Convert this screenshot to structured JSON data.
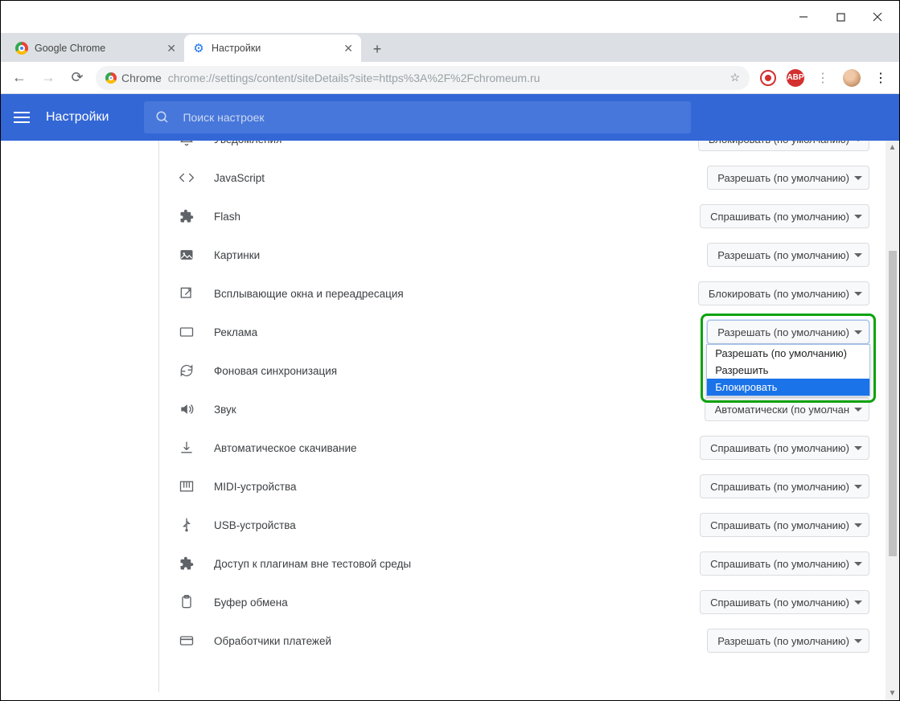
{
  "window": {
    "tabs": [
      {
        "title": "Google Chrome",
        "active": false
      },
      {
        "title": "Настройки",
        "active": true
      }
    ],
    "addressbar": {
      "scheme_label": "Chrome",
      "url": "chrome://settings/content/siteDetails?site=https%3A%2F%2Fchromeum.ru"
    }
  },
  "settings_header": {
    "title": "Настройки",
    "search_placeholder": "Поиск настроек"
  },
  "permissions": [
    {
      "icon": "bell",
      "label": "Уведомления",
      "value": "Блокировать (по умолчанию)"
    },
    {
      "icon": "code",
      "label": "JavaScript",
      "value": "Разрешать (по умолчанию)"
    },
    {
      "icon": "puzzle",
      "label": "Flash",
      "value": "Спрашивать (по умолчанию)"
    },
    {
      "icon": "image",
      "label": "Картинки",
      "value": "Разрешать (по умолчанию)"
    },
    {
      "icon": "popup",
      "label": "Всплывающие окна и переадресация",
      "value": "Блокировать (по умолчанию)"
    },
    {
      "icon": "rect",
      "label": "Реклама",
      "value": "Разрешать (по умолчанию)",
      "open": true
    },
    {
      "icon": "sync",
      "label": "Фоновая синхронизация",
      "value": ""
    },
    {
      "icon": "sound",
      "label": "Звук",
      "value": "Автоматически (по умолчан"
    },
    {
      "icon": "download",
      "label": "Автоматическое скачивание",
      "value": "Спрашивать (по умолчанию)"
    },
    {
      "icon": "midi",
      "label": "MIDI-устройства",
      "value": "Спрашивать (по умолчанию)"
    },
    {
      "icon": "usb",
      "label": "USB-устройства",
      "value": "Спрашивать (по умолчанию)"
    },
    {
      "icon": "puzzle",
      "label": "Доступ к плагинам вне тестовой среды",
      "value": "Спрашивать (по умолчанию)"
    },
    {
      "icon": "clip",
      "label": "Буфер обмена",
      "value": "Спрашивать (по умолчанию)"
    },
    {
      "icon": "card",
      "label": "Обработчики платежей",
      "value": "Разрешать (по умолчанию)"
    }
  ],
  "dropdown_options": [
    {
      "label": "Разрешать (по умолчанию)",
      "selected": false
    },
    {
      "label": "Разрешить",
      "selected": false
    },
    {
      "label": "Блокировать",
      "selected": true
    }
  ]
}
